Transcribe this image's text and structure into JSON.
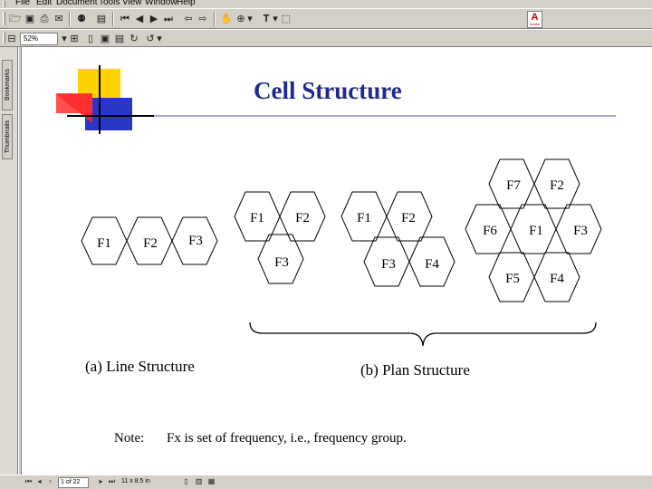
{
  "menu": [
    "File",
    "Edit",
    "Document",
    "Tools",
    "View",
    "Window",
    "Help"
  ],
  "toolbar": {
    "zoom": "52%",
    "row1_icons": [
      "open-icon",
      "save-icon",
      "print-icon",
      "email-icon",
      "search-icon",
      "show-hide-navigation-icon",
      "first-page-icon",
      "previous-page-icon",
      "next-page-icon",
      "last-page-icon",
      "go-back-icon",
      "go-forward-icon",
      "hand-tool-icon",
      "zoom-tool-icon",
      "text-select-icon",
      "graphics-select-icon"
    ],
    "row2_icons": [
      "actual-size-icon",
      "fit-page-icon",
      "fit-width-icon",
      "rotate-icon"
    ]
  },
  "adobe_logo": {
    "mark": "A",
    "word": "Adobe"
  },
  "nav": {
    "bookmarks": "Bookmarks",
    "thumbnails": "Thumbnails"
  },
  "slide": {
    "title": "Cell Structure",
    "title_color": "#1f2a8c",
    "line_caption": "(a) Line Structure",
    "plan_caption": "(b) Plan Structure",
    "note_label": "Note:",
    "note_text": "Fx is set of frequency,  i.e., frequency group.",
    "line_cells": [
      "F1",
      "F2",
      "F3"
    ],
    "plan_groups": [
      {
        "cells": [
          "F1",
          "F2",
          "F3"
        ]
      },
      {
        "cells": [
          "F1",
          "F2",
          "F3",
          "F4"
        ]
      },
      {
        "cells": [
          "F7",
          "F2",
          "F6",
          "F1",
          "F3",
          "F5",
          "F4"
        ]
      }
    ]
  },
  "status": {
    "page": "1 of 22",
    "size": "11 x 8.5 in"
  },
  "colors": {
    "ui_gray": "#d4d0c8",
    "logo_yellow": "#ffd200",
    "logo_red": "#ff2020",
    "logo_blue": "#2a36c8"
  }
}
